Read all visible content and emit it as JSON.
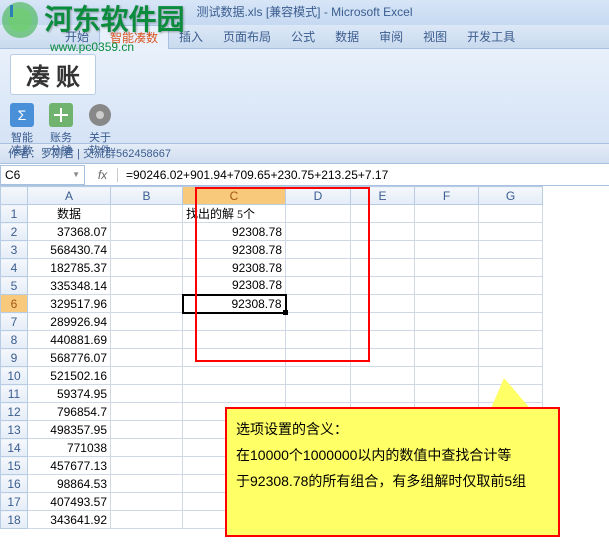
{
  "watermark": {
    "text": "河东软件园",
    "url": "www.pc0359.cn"
  },
  "title": {
    "doc": "测试数据.xls",
    "mode": "[兼容模式]",
    "app": "Microsoft Excel"
  },
  "tabs": {
    "home": "开始",
    "active": "智能凑数",
    "insert": "插入",
    "layout": "页面布局",
    "formula": "公式",
    "data": "数据",
    "review": "审阅",
    "view": "视图",
    "dev": "开发工具"
  },
  "ribbon": {
    "title": "凑 账",
    "items": [
      {
        "line1": "智能",
        "line2": "凑数"
      },
      {
        "line1": "账务",
        "line2": "分摊"
      },
      {
        "line1": "关于",
        "line2": "软件"
      }
    ]
  },
  "author": "作者：罗刚君 | 交流群562458667",
  "formula": {
    "cell": "C6",
    "value": "=90246.02+901.94+709.65+230.75+213.25+7.17"
  },
  "columns": [
    "A",
    "B",
    "C",
    "D",
    "E",
    "F",
    "G"
  ],
  "header": {
    "A": "数据",
    "C": "找出的解 5个"
  },
  "dataA": [
    "37368.07",
    "568430.74",
    "182785.37",
    "335348.14",
    "329517.96",
    "289926.94",
    "440881.69",
    "568776.07",
    "521502.16",
    "59374.95",
    "796854.7",
    "498357.95",
    "771038",
    "457677.13",
    "98864.53",
    "407493.57",
    "343641.92"
  ],
  "dataC": [
    "92308.78",
    "92308.78",
    "92308.78",
    "92308.78",
    "92308.78"
  ],
  "callout": {
    "l1": "选项设置的含义：",
    "l2": "在10000个1000000以内的数值中查找合计等",
    "l3": "于92308.78的所有组合，有多组解时仅取前5组"
  }
}
